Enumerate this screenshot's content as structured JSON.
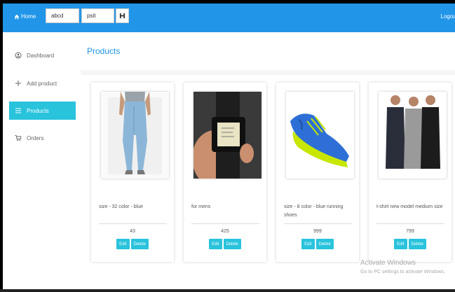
{
  "topbar": {
    "home_label": "Home",
    "search_value_1": "abcd",
    "search_value_2": "psit",
    "logout_label": "Logout"
  },
  "sidebar": {
    "items": [
      {
        "label": "Dashboard",
        "icon": "dashboard-icon"
      },
      {
        "label": "Add product",
        "icon": "plus-icon"
      },
      {
        "label": "Products",
        "icon": "list-icon",
        "active": true
      },
      {
        "label": "Orders",
        "icon": "cart-icon"
      }
    ]
  },
  "main": {
    "title": "Products"
  },
  "products": [
    {
      "description": "size - 32 color - blue",
      "price": "43",
      "edit_label": "Edit",
      "delete_label": "Delete",
      "image": "jeans"
    },
    {
      "description": "for mens",
      "price": "425",
      "edit_label": "Edit",
      "delete_label": "Delete",
      "image": "watch"
    },
    {
      "description": "size - 8 color - blue running shoes",
      "price": "999",
      "edit_label": "Edit",
      "delete_label": "Delete",
      "image": "shoe"
    },
    {
      "description": "t-shirt new model medium size",
      "price": "799",
      "edit_label": "Edit",
      "delete_label": "Delete",
      "image": "tshirts"
    }
  ],
  "watermark": {
    "title": "Activate Windows",
    "subtitle": "Go to PC settings to activate Windows."
  },
  "colors": {
    "primary": "#2196e8",
    "accent": "#29c3dc"
  }
}
